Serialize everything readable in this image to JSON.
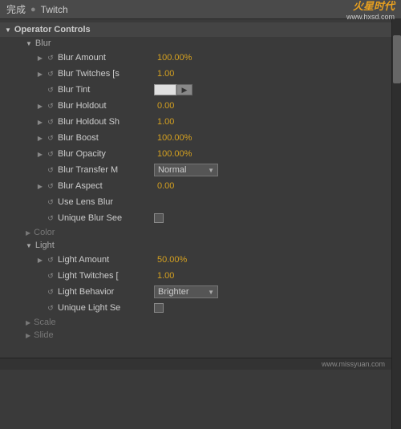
{
  "topbar": {
    "status": "完成",
    "separator": "●",
    "title": "Twitch",
    "logo_text": "火星时代",
    "logo_sub": "www.hxsd.com"
  },
  "panel": {
    "operator_controls_label": "Operator Controls",
    "sections": {
      "blur": {
        "label": "Blur",
        "properties": [
          {
            "id": "blur-amount",
            "has_arrow": true,
            "name": "Blur Amount",
            "value": "100.00%",
            "value_color": "gold"
          },
          {
            "id": "blur-twitches",
            "has_arrow": true,
            "name": "Blur Twitches [s",
            "value": "1.00",
            "value_color": "gold"
          },
          {
            "id": "blur-tint",
            "has_arrow": false,
            "name": "Blur Tint",
            "value": "swatch",
            "value_color": null
          },
          {
            "id": "blur-holdout",
            "has_arrow": true,
            "name": "Blur Holdout",
            "value": "0.00",
            "value_color": "gold"
          },
          {
            "id": "blur-holdout-sh",
            "has_arrow": true,
            "name": "Blur Holdout Sh",
            "value": "1.00",
            "value_color": "gold"
          },
          {
            "id": "blur-boost",
            "has_arrow": true,
            "name": "Blur Boost",
            "value": "100.00%",
            "value_color": "gold"
          },
          {
            "id": "blur-opacity",
            "has_arrow": true,
            "name": "Blur Opacity",
            "value": "100.00%",
            "value_color": "gold"
          },
          {
            "id": "blur-transfer",
            "has_arrow": false,
            "name": "Blur Transfer M",
            "value": "Normal",
            "value_color": "dropdown"
          },
          {
            "id": "blur-aspect",
            "has_arrow": true,
            "name": "Blur Aspect",
            "value": "0.00",
            "value_color": "gold"
          },
          {
            "id": "use-lens-blur",
            "has_arrow": false,
            "name": "Use Lens Blur",
            "value": "none",
            "value_color": null
          },
          {
            "id": "unique-blur-see",
            "has_arrow": false,
            "name": "Unique Blur See",
            "value": "checkbox",
            "value_color": null
          }
        ]
      },
      "color": {
        "label": "Color",
        "collapsed": true
      },
      "light": {
        "label": "Light",
        "properties": [
          {
            "id": "light-amount",
            "has_arrow": true,
            "name": "Light Amount",
            "value": "50.00%",
            "value_color": "gold"
          },
          {
            "id": "light-twitches",
            "has_arrow": false,
            "name": "Light Twitches [",
            "value": "1.00",
            "value_color": "gold"
          },
          {
            "id": "light-behavior",
            "has_arrow": false,
            "name": "Light Behavior",
            "value": "Brighter",
            "value_color": "dropdown"
          },
          {
            "id": "unique-light-se",
            "has_arrow": false,
            "name": "Unique Light Se",
            "value": "checkbox",
            "value_color": null
          }
        ]
      },
      "scale": {
        "label": "Scale",
        "collapsed": true
      },
      "slide": {
        "label": "Slide",
        "collapsed": true
      }
    }
  },
  "footer": {
    "watermark": "www.missyuan.com"
  }
}
